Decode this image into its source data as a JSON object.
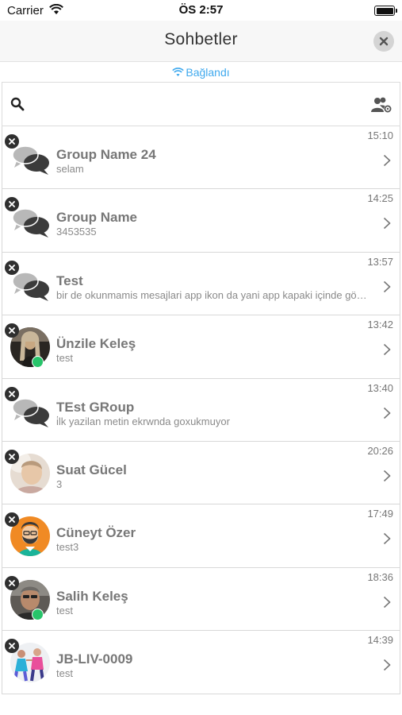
{
  "status_bar": {
    "carrier": "Carrier",
    "time": "ÖS 2:57"
  },
  "nav": {
    "title": "Sohbetler"
  },
  "connection": {
    "status": "Bağlandı",
    "color": "#3fa9ee"
  },
  "search": {
    "value": "",
    "placeholder": ""
  },
  "chats": [
    {
      "name": "Group Name 24",
      "message": "selam",
      "time": "15:10",
      "avatar": "group-chat-icon",
      "online": false
    },
    {
      "name": "Group Name",
      "message": "3453535",
      "time": "14:25",
      "avatar": "group-chat-icon",
      "online": false
    },
    {
      "name": "Test",
      "message": "bir de okunmamis mesajlari app ikon da yani app kapaki içinde gösterilsin",
      "time": "13:57",
      "avatar": "group-chat-icon",
      "online": false
    },
    {
      "name": "Ünzile Keleş",
      "message": "test",
      "time": "13:42",
      "avatar": "photo",
      "online": true
    },
    {
      "name": "TEst GRoup",
      "message": "i̇lk yazilan metin ekrwnda goxukmuyor",
      "time": "13:40",
      "avatar": "group-chat-icon",
      "online": false
    },
    {
      "name": "Suat Gücel",
      "message": "3",
      "time": "20:26",
      "avatar": "photo",
      "online": false
    },
    {
      "name": "Cüneyt Özer",
      "message": "test3",
      "time": "17:49",
      "avatar": "illustration",
      "online": false
    },
    {
      "name": "Salih Keleş",
      "message": "test",
      "time": "18:36",
      "avatar": "photo",
      "online": true
    },
    {
      "name": "JB-LIV-0009",
      "message": "test",
      "time": "14:39",
      "avatar": "photo",
      "online": false
    }
  ],
  "colors": {
    "online": "#27c46a",
    "accent": "#3fa9ee",
    "name_text": "#777777"
  }
}
